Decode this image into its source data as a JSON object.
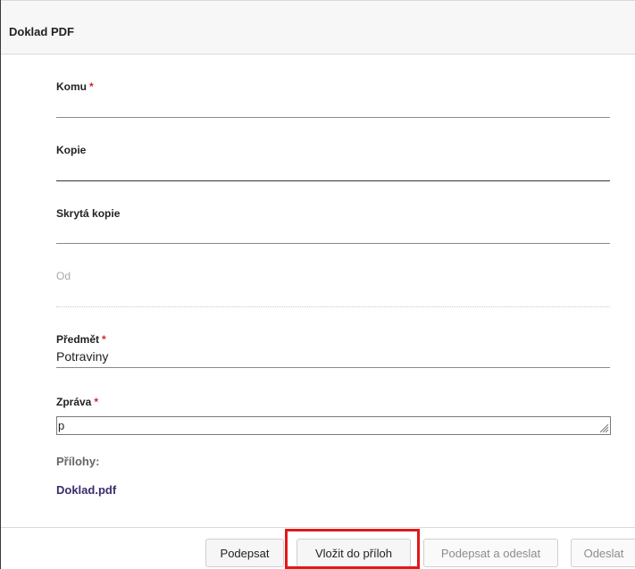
{
  "dialog": {
    "title": "Doklad PDF"
  },
  "form": {
    "to": {
      "label": "Komu",
      "required": "*"
    },
    "cc": {
      "label": "Kopie"
    },
    "bcc": {
      "label": "Skrytá kopie"
    },
    "from": {
      "label": "Od"
    },
    "subject": {
      "label": "Předmět",
      "required": "*",
      "value": "Potraviny"
    },
    "message": {
      "label": "Zpráva",
      "required": "*",
      "value": "p"
    },
    "attachments": {
      "label": "Přílohy:",
      "files": [
        "Doklad.pdf"
      ]
    }
  },
  "footer": {
    "buttons": {
      "sign": "Podepsat",
      "insert_attachments": "Vložit do příloh",
      "sign_and_send": "Podepsat a odeslat",
      "send": "Odeslat"
    }
  },
  "colors": {
    "highlight": "#e0191b",
    "required": "#d9232d",
    "link": "#3c2b6d"
  }
}
